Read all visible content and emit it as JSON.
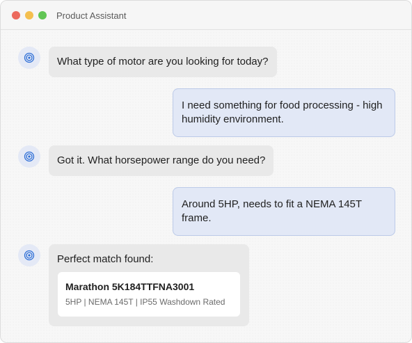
{
  "window": {
    "title": "Product Assistant"
  },
  "messages": [
    {
      "role": "assistant",
      "text": "What type of motor are you looking for today?"
    },
    {
      "role": "user",
      "text": "I need something for food processing - high humidity environment."
    },
    {
      "role": "assistant",
      "text": "Got it. What horsepower range do you need?"
    },
    {
      "role": "user",
      "text": "Around 5HP, needs to fit a NEMA 145T frame."
    },
    {
      "role": "assistant",
      "text": "Perfect match found:"
    }
  ],
  "product": {
    "name": "Marathon 5K184TTFNA3001",
    "specs": "5HP | NEMA 145T | IP55 Washdown Rated"
  },
  "colors": {
    "assistant_bubble": "#e9e9e9",
    "user_bubble": "#e2e8f6",
    "avatar_accent": "#2f6fd6"
  },
  "icons": {
    "avatar": "target-icon"
  }
}
